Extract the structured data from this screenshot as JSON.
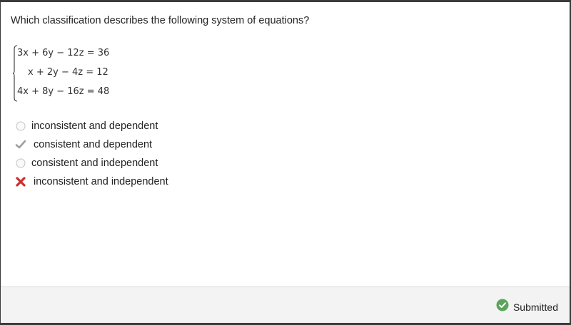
{
  "question": {
    "text": "Which classification describes the following system of equations?"
  },
  "system": {
    "equations": [
      "3x + 6y − 12z = 36",
      "x + 2y − 4z = 12",
      "4x + 8y − 16z = 48"
    ]
  },
  "options": [
    {
      "label": "inconsistent and dependent",
      "state": "unselected",
      "icon": "radio-empty-icon"
    },
    {
      "label": "consistent and dependent",
      "state": "correct-answer",
      "icon": "gray-check-icon"
    },
    {
      "label": "consistent and independent",
      "state": "unselected",
      "icon": "radio-empty-icon"
    },
    {
      "label": "inconsistent and independent",
      "state": "selected-wrong",
      "icon": "red-x-icon"
    }
  ],
  "footer": {
    "status_text": "Submitted",
    "status_icon": "green-check-circle-icon"
  },
  "colors": {
    "correct": "#5aa55a",
    "wrong": "#c9302c",
    "neutral_check": "#a0a0a0"
  }
}
